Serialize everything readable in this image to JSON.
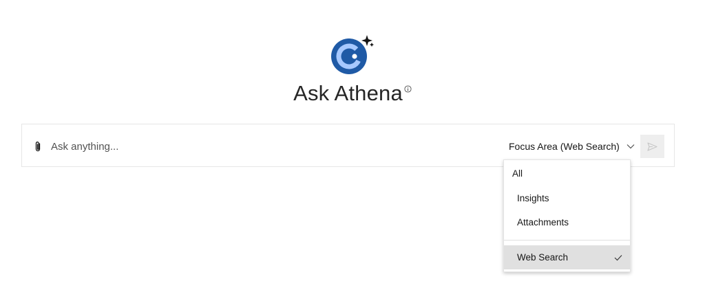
{
  "header": {
    "title": "Ask Athena",
    "logo_icon": "athena-logo-icon",
    "info_icon": "info-icon"
  },
  "search": {
    "placeholder": "Ask anything...",
    "value": "",
    "attach_icon": "paperclip-icon",
    "focus_area_label": "Focus Area (Web Search)",
    "focus_chevron_icon": "chevron-down-icon",
    "send_icon": "send-icon"
  },
  "dropdown": {
    "items": [
      {
        "label": "All"
      },
      {
        "label": "Insights"
      },
      {
        "label": "Attachments"
      },
      {
        "label": "Web Search",
        "selected": true,
        "icon": "checkmark-icon"
      }
    ]
  },
  "colors": {
    "brand_blue": "#1f5aa6",
    "light_blue": "#a6c8ff",
    "selected_bg": "#e0e0e0",
    "send_bg": "#eeeeee"
  }
}
